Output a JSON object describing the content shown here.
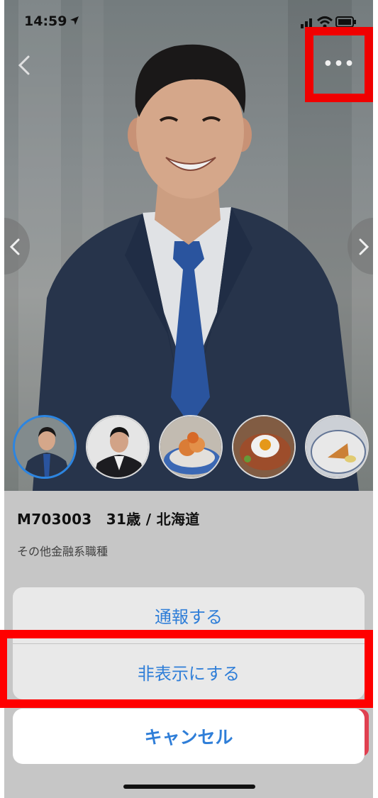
{
  "status_bar": {
    "time": "14:59"
  },
  "header": {
    "more_label": "•••"
  },
  "profile": {
    "title": "M703003　31歳 / 北海道",
    "job": "その他金融系職種",
    "photo_count_shown": 5
  },
  "action_sheet": {
    "report_label": "通報する",
    "hide_label": "非表示にする",
    "cancel_label": "キャンセル"
  },
  "colors": {
    "accent": "#2f7ed8",
    "highlight": "#ff0000",
    "active_thumb_border": "#2f8ef0"
  },
  "icons": {
    "back": "chevron-left-icon",
    "more": "ellipsis-icon",
    "prev_photo": "chevron-left-icon",
    "next_photo": "chevron-right-icon",
    "location": "location-arrow-icon",
    "signal": "signal-icon",
    "wifi": "wifi-icon",
    "battery": "battery-icon"
  }
}
